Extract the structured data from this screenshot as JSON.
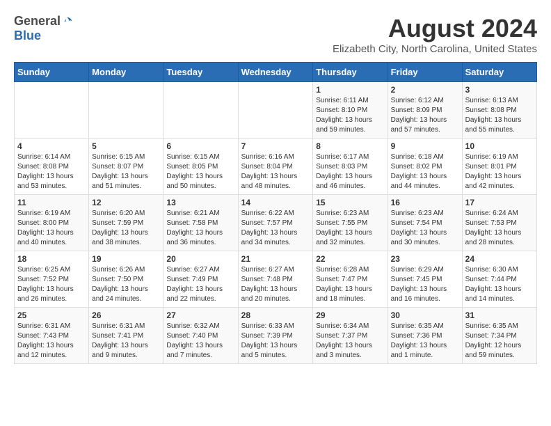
{
  "header": {
    "logo_general": "General",
    "logo_blue": "Blue",
    "main_title": "August 2024",
    "sub_title": "Elizabeth City, North Carolina, United States"
  },
  "calendar": {
    "days_of_week": [
      "Sunday",
      "Monday",
      "Tuesday",
      "Wednesday",
      "Thursday",
      "Friday",
      "Saturday"
    ],
    "weeks": [
      [
        {
          "day": "",
          "info": ""
        },
        {
          "day": "",
          "info": ""
        },
        {
          "day": "",
          "info": ""
        },
        {
          "day": "",
          "info": ""
        },
        {
          "day": "1",
          "info": "Sunrise: 6:11 AM\nSunset: 8:10 PM\nDaylight: 13 hours\nand 59 minutes."
        },
        {
          "day": "2",
          "info": "Sunrise: 6:12 AM\nSunset: 8:09 PM\nDaylight: 13 hours\nand 57 minutes."
        },
        {
          "day": "3",
          "info": "Sunrise: 6:13 AM\nSunset: 8:08 PM\nDaylight: 13 hours\nand 55 minutes."
        }
      ],
      [
        {
          "day": "4",
          "info": "Sunrise: 6:14 AM\nSunset: 8:08 PM\nDaylight: 13 hours\nand 53 minutes."
        },
        {
          "day": "5",
          "info": "Sunrise: 6:15 AM\nSunset: 8:07 PM\nDaylight: 13 hours\nand 51 minutes."
        },
        {
          "day": "6",
          "info": "Sunrise: 6:15 AM\nSunset: 8:05 PM\nDaylight: 13 hours\nand 50 minutes."
        },
        {
          "day": "7",
          "info": "Sunrise: 6:16 AM\nSunset: 8:04 PM\nDaylight: 13 hours\nand 48 minutes."
        },
        {
          "day": "8",
          "info": "Sunrise: 6:17 AM\nSunset: 8:03 PM\nDaylight: 13 hours\nand 46 minutes."
        },
        {
          "day": "9",
          "info": "Sunrise: 6:18 AM\nSunset: 8:02 PM\nDaylight: 13 hours\nand 44 minutes."
        },
        {
          "day": "10",
          "info": "Sunrise: 6:19 AM\nSunset: 8:01 PM\nDaylight: 13 hours\nand 42 minutes."
        }
      ],
      [
        {
          "day": "11",
          "info": "Sunrise: 6:19 AM\nSunset: 8:00 PM\nDaylight: 13 hours\nand 40 minutes."
        },
        {
          "day": "12",
          "info": "Sunrise: 6:20 AM\nSunset: 7:59 PM\nDaylight: 13 hours\nand 38 minutes."
        },
        {
          "day": "13",
          "info": "Sunrise: 6:21 AM\nSunset: 7:58 PM\nDaylight: 13 hours\nand 36 minutes."
        },
        {
          "day": "14",
          "info": "Sunrise: 6:22 AM\nSunset: 7:57 PM\nDaylight: 13 hours\nand 34 minutes."
        },
        {
          "day": "15",
          "info": "Sunrise: 6:23 AM\nSunset: 7:55 PM\nDaylight: 13 hours\nand 32 minutes."
        },
        {
          "day": "16",
          "info": "Sunrise: 6:23 AM\nSunset: 7:54 PM\nDaylight: 13 hours\nand 30 minutes."
        },
        {
          "day": "17",
          "info": "Sunrise: 6:24 AM\nSunset: 7:53 PM\nDaylight: 13 hours\nand 28 minutes."
        }
      ],
      [
        {
          "day": "18",
          "info": "Sunrise: 6:25 AM\nSunset: 7:52 PM\nDaylight: 13 hours\nand 26 minutes."
        },
        {
          "day": "19",
          "info": "Sunrise: 6:26 AM\nSunset: 7:50 PM\nDaylight: 13 hours\nand 24 minutes."
        },
        {
          "day": "20",
          "info": "Sunrise: 6:27 AM\nSunset: 7:49 PM\nDaylight: 13 hours\nand 22 minutes."
        },
        {
          "day": "21",
          "info": "Sunrise: 6:27 AM\nSunset: 7:48 PM\nDaylight: 13 hours\nand 20 minutes."
        },
        {
          "day": "22",
          "info": "Sunrise: 6:28 AM\nSunset: 7:47 PM\nDaylight: 13 hours\nand 18 minutes."
        },
        {
          "day": "23",
          "info": "Sunrise: 6:29 AM\nSunset: 7:45 PM\nDaylight: 13 hours\nand 16 minutes."
        },
        {
          "day": "24",
          "info": "Sunrise: 6:30 AM\nSunset: 7:44 PM\nDaylight: 13 hours\nand 14 minutes."
        }
      ],
      [
        {
          "day": "25",
          "info": "Sunrise: 6:31 AM\nSunset: 7:43 PM\nDaylight: 13 hours\nand 12 minutes."
        },
        {
          "day": "26",
          "info": "Sunrise: 6:31 AM\nSunset: 7:41 PM\nDaylight: 13 hours\nand 9 minutes."
        },
        {
          "day": "27",
          "info": "Sunrise: 6:32 AM\nSunset: 7:40 PM\nDaylight: 13 hours\nand 7 minutes."
        },
        {
          "day": "28",
          "info": "Sunrise: 6:33 AM\nSunset: 7:39 PM\nDaylight: 13 hours\nand 5 minutes."
        },
        {
          "day": "29",
          "info": "Sunrise: 6:34 AM\nSunset: 7:37 PM\nDaylight: 13 hours\nand 3 minutes."
        },
        {
          "day": "30",
          "info": "Sunrise: 6:35 AM\nSunset: 7:36 PM\nDaylight: 13 hours\nand 1 minute."
        },
        {
          "day": "31",
          "info": "Sunrise: 6:35 AM\nSunset: 7:34 PM\nDaylight: 12 hours\nand 59 minutes."
        }
      ]
    ]
  }
}
